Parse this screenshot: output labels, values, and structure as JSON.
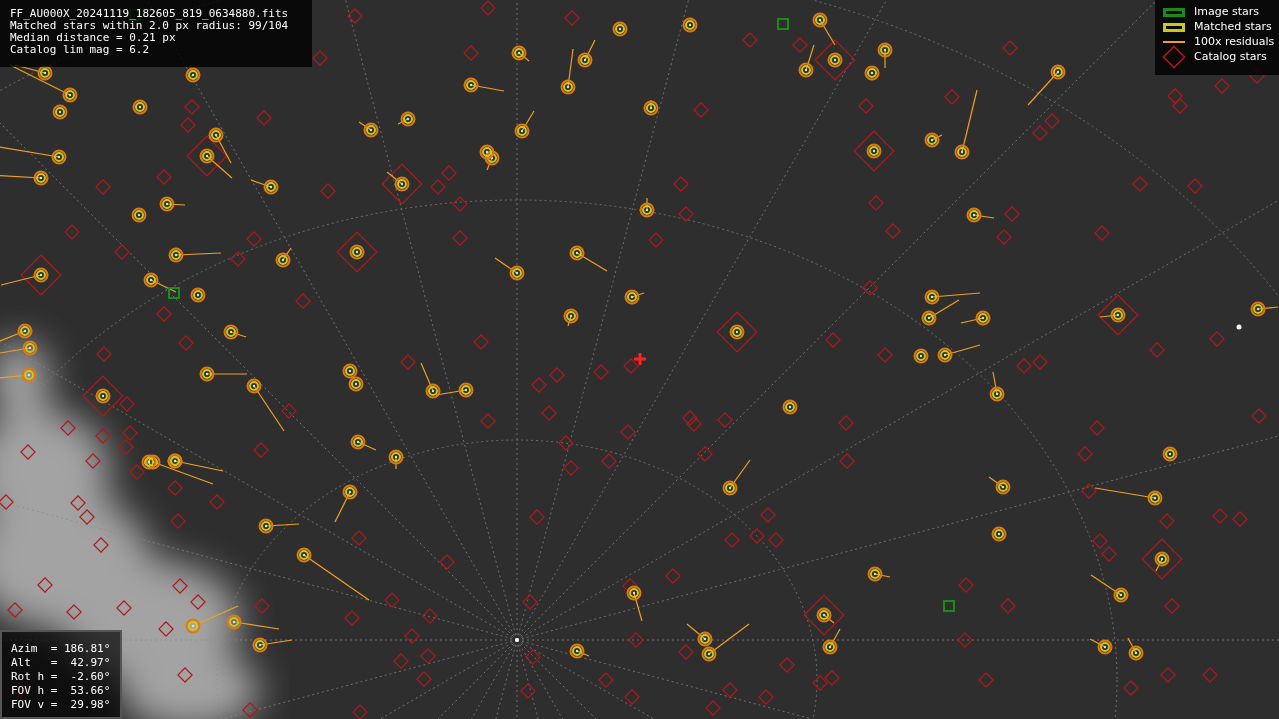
{
  "info": {
    "lines": [
      "FF_AU000X_20241119_182605_819_0634880.fits",
      "Matched stars within 2.0 px radius: 99/104",
      "Median distance = 0.21 px",
      "Catalog lim mag = 6.2"
    ]
  },
  "legend": [
    {
      "kind": "box",
      "label": "Image stars",
      "color": "#1a8a1a"
    },
    {
      "kind": "box",
      "label": "Matched stars",
      "color": "#c8c820"
    },
    {
      "kind": "line",
      "label": "100x residuals",
      "color": "#f0a020"
    },
    {
      "kind": "diamond",
      "label": "Catalog stars",
      "color": "#b01818"
    }
  ],
  "pointing": {
    "lines": [
      "Azim  = 186.81°",
      "Alt   =  42.97°",
      "Rot h =  -2.60°",
      "FOV h =  53.66°",
      "FOV v =  29.98°"
    ]
  }
}
